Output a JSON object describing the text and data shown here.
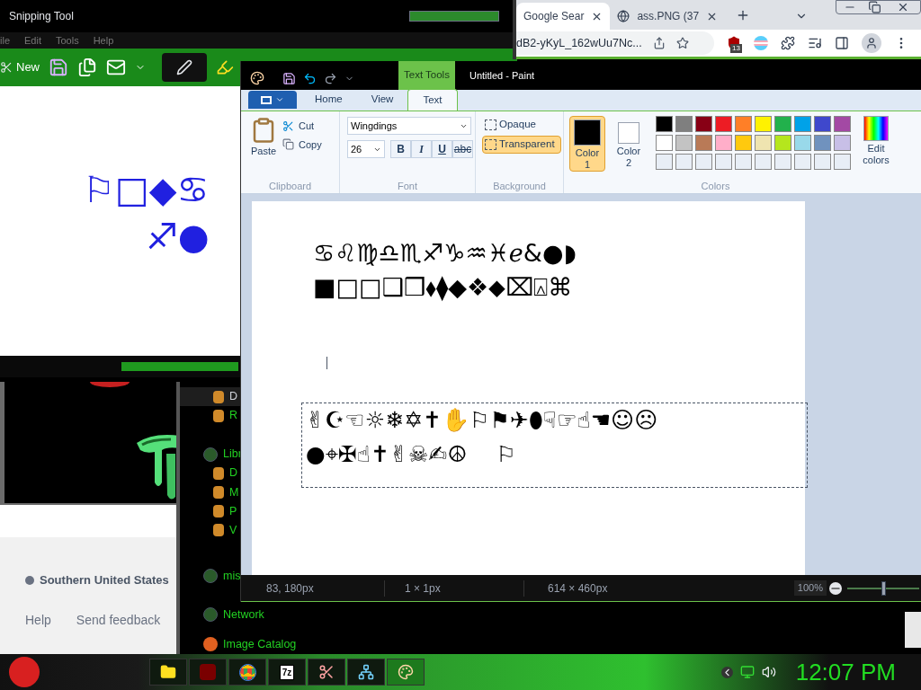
{
  "snipping_tool": {
    "title": "Snipping Tool",
    "menu": [
      "ile",
      "Edit",
      "Tools",
      "Help"
    ],
    "new_label": "New",
    "canvas_lines": [
      "⚐□◆♋",
      "♐●"
    ]
  },
  "browser": {
    "tabs": [
      {
        "label": "Google Sear",
        "selected": true
      },
      {
        "label": "ass.PNG (37",
        "selected": false
      }
    ],
    "address": "dB2-yKyL_162wUu7Nc...",
    "extension_badge": "13"
  },
  "web_page": {
    "location": "Southern United States",
    "links": [
      "Help",
      "Send feedback"
    ]
  },
  "explorer_nav": [
    {
      "label": "D",
      "kind": "item",
      "selected": true
    },
    {
      "label": "R",
      "kind": "item",
      "selected": false
    },
    {
      "label": "Libr",
      "kind": "group",
      "selected": false
    },
    {
      "label": "D",
      "kind": "item",
      "selected": false
    },
    {
      "label": "M",
      "kind": "item",
      "selected": false
    },
    {
      "label": "P",
      "kind": "item",
      "selected": false
    },
    {
      "label": "V",
      "kind": "item",
      "selected": false
    },
    {
      "label": "mis",
      "kind": "group",
      "selected": false
    },
    {
      "label": "Network",
      "kind": "group",
      "selected": false
    },
    {
      "label": "Image Catalog",
      "kind": "catalog",
      "selected": false
    }
  ],
  "paint": {
    "title": "Untitled - Paint",
    "contextual_tab": "Text Tools",
    "tabs": [
      {
        "label": "Home",
        "selected": false
      },
      {
        "label": "View",
        "selected": false
      },
      {
        "label": "Text",
        "selected": true
      }
    ],
    "clipboard": {
      "label": "Clipboard",
      "paste": "Paste",
      "cut": "Cut",
      "copy": "Copy"
    },
    "font": {
      "label": "Font",
      "family": "Wingdings",
      "size": "26",
      "styles": [
        {
          "label": "B",
          "kind": "bold",
          "on": false
        },
        {
          "label": "I",
          "kind": "italic",
          "on": false
        },
        {
          "label": "U",
          "kind": "underline",
          "on": false
        },
        {
          "label": "abc",
          "kind": "strike",
          "on": false
        }
      ]
    },
    "background": {
      "label": "Background",
      "options": [
        {
          "label": "Opaque",
          "selected": false
        },
        {
          "label": "Transparent",
          "selected": true
        }
      ]
    },
    "colors": {
      "label": "Colors",
      "edit": "Edit colors",
      "slots": [
        {
          "label": "Color 1",
          "color": "#000000",
          "selected": true
        },
        {
          "label": "Color 2",
          "color": "#ffffff",
          "selected": false
        }
      ],
      "palette": [
        {
          "color": "#000000"
        },
        {
          "color": "#7f7f7f"
        },
        {
          "color": "#880015"
        },
        {
          "color": "#ed1c24"
        },
        {
          "color": "#ff7f27"
        },
        {
          "color": "#fff200"
        },
        {
          "color": "#22b14c"
        },
        {
          "color": "#00a2e8"
        },
        {
          "color": "#3f48cc"
        },
        {
          "color": "#a349a4"
        },
        {
          "color": "#ffffff"
        },
        {
          "color": "#c3c3c3"
        },
        {
          "color": "#b97a57"
        },
        {
          "color": "#ffaec9"
        },
        {
          "color": "#ffc90e"
        },
        {
          "color": "#efe4b0"
        },
        {
          "color": "#b5e61d"
        },
        {
          "color": "#99d9ea"
        },
        {
          "color": "#7092be"
        },
        {
          "color": "#c8bfe7"
        }
      ]
    },
    "canvas": {
      "lines": [
        "♋♌♍♎♏♐♑♒♓ℯ&●◗",
        "■□□❑❒⬧⧫◆❖⬥⌧⍓⌘"
      ],
      "selection_lines": [
        "✌☪☜☼❄✡✝✋⚐⚑✈⬮☟☞☝☚☺☹",
        "●⌖✠☝✝✌☠✍☮    ⚐"
      ]
    },
    "status": {
      "cursor": "83, 180px",
      "selection": "1 × 1px",
      "size": "614 × 460px",
      "zoom": "100%",
      "zoom_slider": {
        "level": 0.5
      }
    }
  },
  "taskbar": {
    "apps": [
      {
        "kind": "folder",
        "active": false
      },
      {
        "kind": "flash",
        "active": false
      },
      {
        "kind": "browser",
        "active": false
      },
      {
        "kind": "archive",
        "label": "7z",
        "active": false
      },
      {
        "kind": "snipping",
        "active": false
      },
      {
        "kind": "network",
        "active": false
      },
      {
        "kind": "paint",
        "active": true
      }
    ],
    "clock": "12:07 PM"
  }
}
